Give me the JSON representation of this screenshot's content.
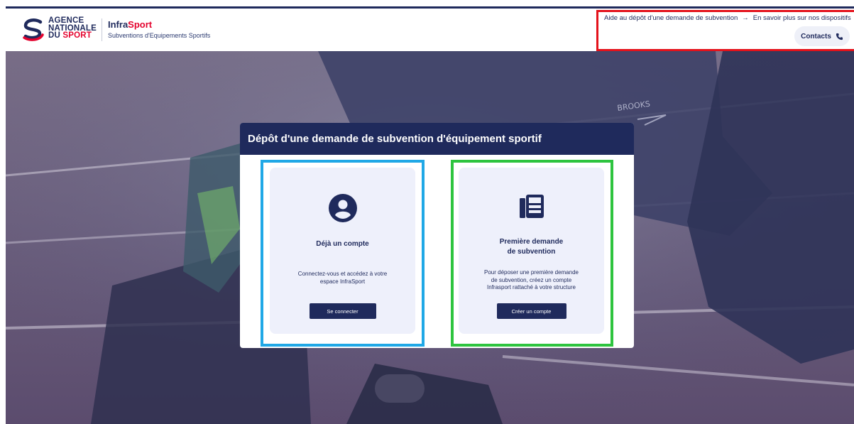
{
  "header": {
    "agency_line1": "AGENCE",
    "agency_line2": "NATIONALE",
    "agency_du": "DU",
    "agency_sport": "SPORT",
    "app_name_part1": "Infra",
    "app_name_part2": "Sport",
    "app_subtitle": "Subventions d'Equipements Sportifs",
    "help_link_1": "Aide au dépôt d'une demande de subvention",
    "help_link_2": "En savoir plus sur nos dispositifs",
    "contacts_label": "Contacts"
  },
  "dialog": {
    "title": "Dépôt d'une demande de subvention d'équipement sportif",
    "existing_account": {
      "title": "Déjà un compte",
      "description_line1": "Connectez-vous et accédez à votre",
      "description_line2": "espace InfraSport",
      "button": "Se connecter",
      "icon": "user-circle-icon"
    },
    "first_request": {
      "title_line1": "Première demande",
      "title_line2": "de subvention",
      "description_line1": "Pour déposer une première demande",
      "description_line2": "de subvention, créez un compte",
      "description_line3": "Infrasport rattaché à votre structure",
      "button": "Créer un compte",
      "icon": "fax-icon"
    }
  },
  "hero": {
    "shoe_brand": "BROOKS"
  },
  "colors": {
    "navy": "#1f2a5c",
    "red": "#e4032e",
    "card_bg": "#eef0fb",
    "highlight_red": "#e4121b",
    "highlight_blue": "#20a8e6",
    "highlight_green": "#2ec43f"
  }
}
